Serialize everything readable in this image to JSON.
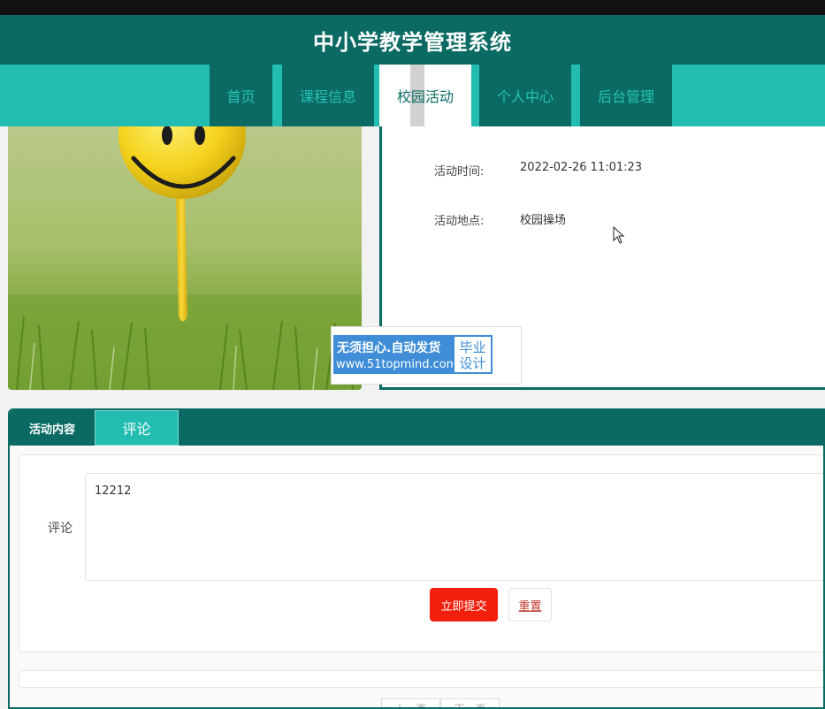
{
  "app": {
    "title": "中小学教学管理系统"
  },
  "nav": {
    "items": [
      {
        "label": "首页"
      },
      {
        "label": "课程信息"
      },
      {
        "label": "校园活动"
      },
      {
        "label": "个人中心"
      },
      {
        "label": "后台管理"
      }
    ],
    "active_index": 2
  },
  "activity": {
    "time_label": "活动时间:",
    "time_value": "2022-02-26 11:01:23",
    "place_label": "活动地点:",
    "place_value": "校园操场"
  },
  "watermark": {
    "line1": "无须担心.自动发货",
    "line2": "www.51topmind.com",
    "right_line1": "毕业",
    "right_line2": "设计"
  },
  "tabs": [
    {
      "label": "活动内容"
    },
    {
      "label": "评论"
    }
  ],
  "comment_form": {
    "label": "评论",
    "value": "12212",
    "submit_label": "立即提交",
    "reset_label": "重置"
  },
  "pager": {
    "prev_label": "上一页",
    "next_label": "下一页"
  },
  "colors": {
    "primary": "#0b6b64",
    "accent": "#22bcb0",
    "submit": "#f21f0c"
  }
}
